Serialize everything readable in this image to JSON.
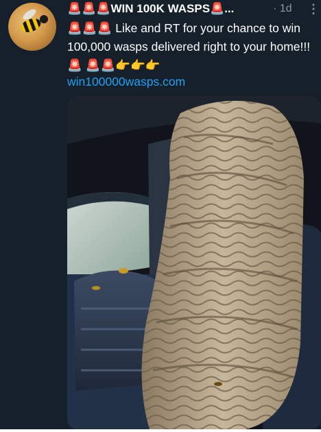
{
  "tweet": {
    "name": "🚨🚨🚨WIN 100K WASPS🚨...",
    "time": "· 1d",
    "more_icon": "⋮",
    "text": "🚨🚨🚨 Like and RT for your chance to win 100,000 wasps delivered right to your home!!!🚨 🚨🚨👉👉👉",
    "link": "win100000wasps.com"
  },
  "colors": {
    "background": "#15202b",
    "link": "#1da1f2",
    "muted": "#8899a6"
  }
}
